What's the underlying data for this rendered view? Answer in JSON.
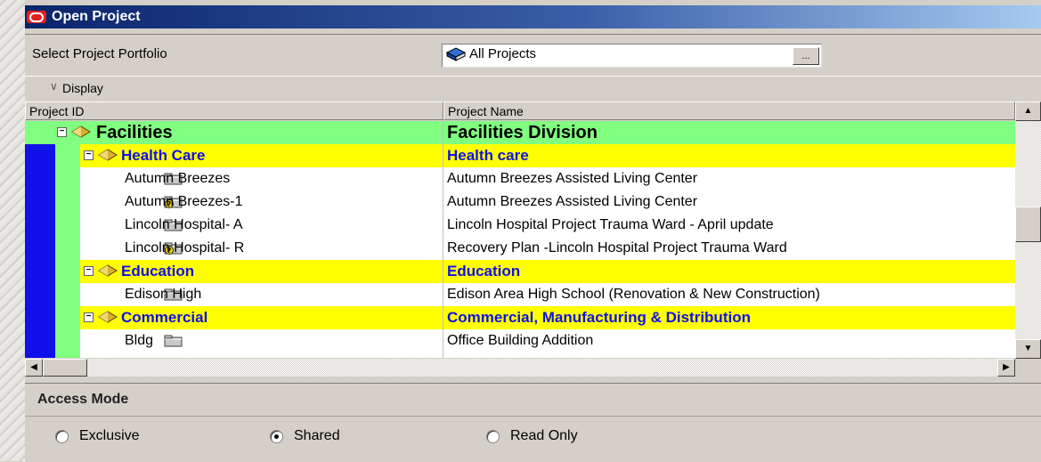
{
  "window": {
    "title": "Open Project"
  },
  "portfolio": {
    "label": "Select Project Portfolio",
    "value": "All Projects",
    "browse_label": "..."
  },
  "display": {
    "label": "Display"
  },
  "columns": {
    "id": "Project ID",
    "name": "Project Name"
  },
  "rows": [
    {
      "level": 1,
      "id": "Facilities",
      "name": "Facilities Division"
    },
    {
      "level": 2,
      "id": "Health Care",
      "name": "Health care"
    },
    {
      "level": 3,
      "id": "Autumn Breezes",
      "name": "Autumn Breezes Assisted Living Center",
      "icon": "folder-icon"
    },
    {
      "level": 3,
      "id": "Autumn Breezes-1",
      "name": "Autumn Breezes Assisted Living Center",
      "icon": "whatif-folder-icon"
    },
    {
      "level": 3,
      "id": "Lincoln Hospital- A",
      "name": "Lincoln Hospital Project Trauma Ward - April update",
      "icon": "folder-icon"
    },
    {
      "level": 3,
      "id": "Lincoln Hospital- R",
      "name": "Recovery Plan -Lincoln Hospital Project Trauma Ward",
      "icon": "whatif-folder-icon"
    },
    {
      "level": 2,
      "id": "Education",
      "name": "Education"
    },
    {
      "level": 3,
      "id": "Edison High",
      "name": "Edison Area High School (Renovation & New Construction)",
      "icon": "folder-icon"
    },
    {
      "level": 2,
      "id": "Commercial",
      "name": "Commercial, Manufacturing & Distribution"
    },
    {
      "level": 3,
      "id": "Bldg",
      "name": "Office Building Addition",
      "icon": "folder-icon"
    }
  ],
  "access_mode": {
    "title": "Access Mode",
    "options": [
      {
        "label": "Exclusive",
        "selected": false
      },
      {
        "label": "Shared",
        "selected": true
      },
      {
        "label": "Read Only",
        "selected": false
      }
    ]
  },
  "colors": {
    "wbs_level1": "#80ff80",
    "wbs_level2": "#ffff00",
    "wbs_text": "#1010e8",
    "title_bar": "#0a246a"
  }
}
